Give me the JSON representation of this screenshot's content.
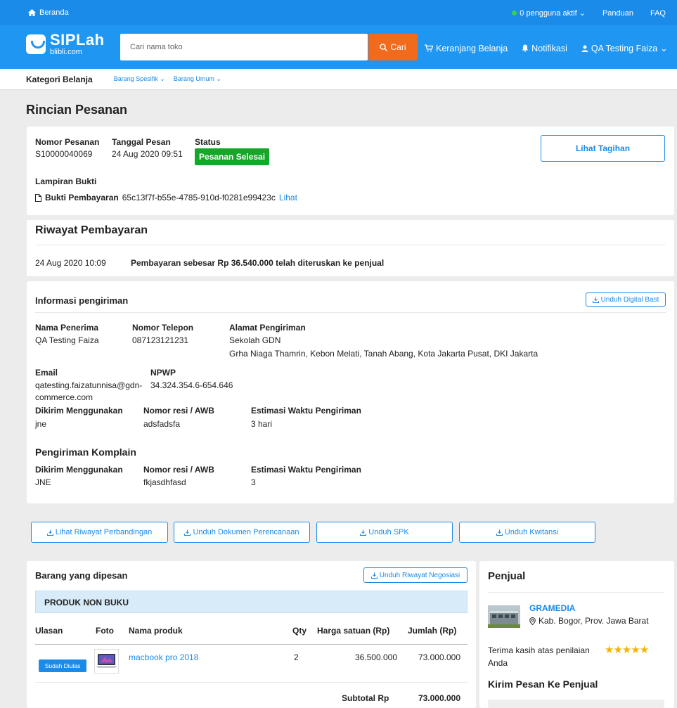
{
  "topbar": {
    "home": "Beranda",
    "active_users": "0 pengguna aktif",
    "guide": "Panduan",
    "faq": "FAQ"
  },
  "header": {
    "logo_main": "SIPLah",
    "logo_sub": "blibli.com",
    "search_placeholder": "Cari nama toko",
    "search_button": "Cari",
    "cart": "Keranjang Belanja",
    "notifications": "Notifikasi",
    "user": "QA Testing Faiza"
  },
  "categories": {
    "title": "Kategori Belanja",
    "items": [
      "Barang Spesifik",
      "Barang Umum"
    ]
  },
  "page_title": "Rincian Pesanan",
  "order": {
    "number_label": "Nomor Pesanan",
    "number": "S10000040069",
    "date_label": "Tanggal Pesan",
    "date": "24 Aug 2020 09:51",
    "status_label": "Status",
    "status": "Pesanan Selesai",
    "invoice_button": "Lihat Tagihan",
    "attachment_label": "Lampiran Bukti",
    "proof_label": "Bukti Pembayaran",
    "proof_id": "65c13f7f-b55e-4785-910d-f0281e99423c",
    "proof_link": "Lihat"
  },
  "payment_history": {
    "title": "Riwayat Pembayaran",
    "date": "24 Aug 2020 10:09",
    "text": "Pembayaran sebesar Rp 36.540.000 telah diteruskan ke penjual"
  },
  "shipping": {
    "title": "Informasi pengiriman",
    "download_bast": "Unduh Digital Bast",
    "recipient_label": "Nama Penerima",
    "recipient": "QA Testing Faiza",
    "phone_label": "Nomor Telepon",
    "phone": "087123121231",
    "address_label": "Alamat Pengiriman",
    "address_line1": "Sekolah GDN",
    "address_line2": "Grha Niaga Thamrin, Kebon Melati, Tanah Abang, Kota Jakarta Pusat, DKI Jakarta",
    "email_label": "Email",
    "email_line1": "qatesting.faizatunnisa@gdn-",
    "email_line2": "commerce.com",
    "npwp_label": "NPWP",
    "npwp": "34.324.354.6-654.646",
    "courier_label": "Dikirim Menggunakan",
    "courier": "jne",
    "awb_label": "Nomor resi / AWB",
    "awb": "adsfadsfa",
    "eta_label": "Estimasi Waktu Pengiriman",
    "eta": "3 hari",
    "complaint_title": "Pengiriman Komplain",
    "c_courier_label": "Dikirim Menggunakan",
    "c_courier": "JNE",
    "c_awb_label": "Nomor resi / AWB",
    "c_awb": "fkjasdhfasd",
    "c_eta_label": "Estimasi Waktu Pengiriman",
    "c_eta": "3"
  },
  "actions": {
    "compare_history": "Lihat Riwayat Perbandingan",
    "planning_doc": "Unduh Dokumen Perencanaan",
    "spk": "Unduh SPK",
    "receipt": "Unduh Kwitansi"
  },
  "items": {
    "title": "Barang yang dipesan",
    "negotiation": "Unduh Riwayat Negosiasi",
    "group": "PRODUK NON BUKU",
    "columns": {
      "review": "Ulasan",
      "photo": "Foto",
      "name": "Nama produk",
      "qty": "Qty",
      "unit_price": "Harga satuan (Rp)",
      "total": "Jumlah (Rp)"
    },
    "rows": [
      {
        "review": "Sudah Diulas",
        "name": "macbook pro 2018",
        "qty": "2",
        "unit_price": "36.500.000",
        "total": "73.000.000"
      }
    ],
    "subtotal_label": "Subtotal Rp",
    "subtotal": "73.000.000"
  },
  "seller": {
    "title": "Penjual",
    "name": "GRAMEDIA",
    "location": "Kab. Bogor, Prov. Jawa Barat",
    "thanks": "Terima kasih atas penilaian Anda",
    "rating": 5,
    "message_title": "Kirim Pesan Ke Penjual"
  },
  "colors": {
    "primary": "#2096f3",
    "topbar": "#1b8bea",
    "search_button": "#f26a1b",
    "status_green": "#16a629",
    "star": "#f5b400"
  }
}
